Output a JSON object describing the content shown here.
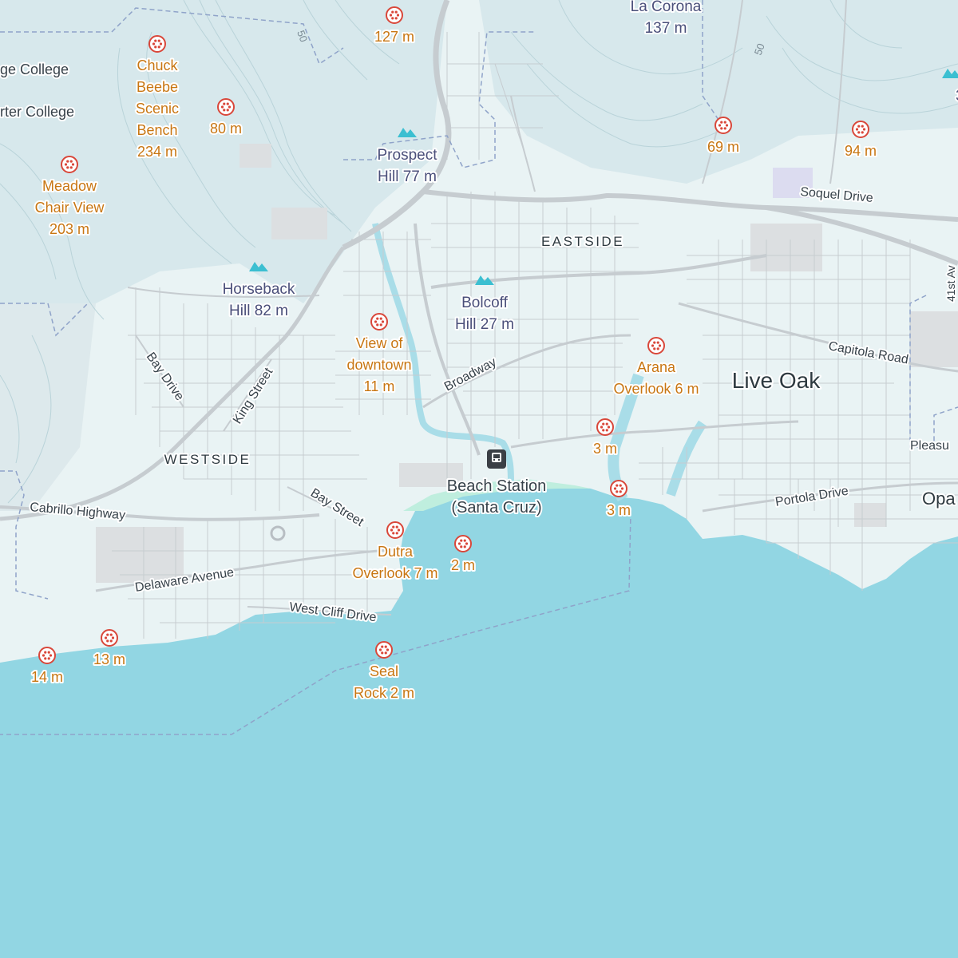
{
  "colors": {
    "water": "#92d6e3",
    "land": "#e9f3f4",
    "hills": "#d7e8ec",
    "contour": "#b9d3d9",
    "road": "#c6ccd0",
    "major_road": "#b8bec3",
    "urban": "#dcdfe1",
    "beach": "#bfeede",
    "viewpoint": "#d9473a",
    "viewpoint_text": "#c87612",
    "peak": "#3bbfd1",
    "peak_text": "#4a4f7a",
    "place_text": "#2e3a40",
    "road_text": "#37424a",
    "boundary": "#8fa3c9"
  },
  "viewpoints": [
    {
      "name": "top-viewpoint",
      "label": [
        "127 m"
      ]
    },
    {
      "name": "chuck-beebe-viewpoint",
      "label": [
        "Chuck",
        "Beebe",
        "Scenic",
        "Bench",
        "234 m"
      ]
    },
    {
      "name": "viewpoint-80",
      "label": [
        "80 m"
      ]
    },
    {
      "name": "meadow-chair-viewpoint",
      "label": [
        "Meadow",
        "Chair View",
        "203 m"
      ]
    },
    {
      "name": "viewpoint-69",
      "label": [
        "69 m"
      ]
    },
    {
      "name": "viewpoint-94",
      "label": [
        "94 m"
      ]
    },
    {
      "name": "view-of-downtown-viewpoint",
      "label": [
        "View of",
        "downtown",
        "11 m"
      ]
    },
    {
      "name": "arana-overlook-viewpoint",
      "label": [
        "Arana",
        "Overlook 6 m"
      ]
    },
    {
      "name": "harbor-viewpoint-a",
      "label": [
        "3 m"
      ]
    },
    {
      "name": "harbor-viewpoint-b",
      "label": [
        "3 m"
      ]
    },
    {
      "name": "dutra-overlook-viewpoint",
      "label": [
        "Dutra",
        "Overlook 7 m"
      ]
    },
    {
      "name": "viewpoint-2",
      "label": [
        "2 m"
      ]
    },
    {
      "name": "viewpoint-13",
      "label": [
        "13 m"
      ]
    },
    {
      "name": "viewpoint-14",
      "label": [
        "14 m"
      ]
    },
    {
      "name": "seal-rock-viewpoint",
      "label": [
        "Seal",
        "Rock 2 m"
      ]
    }
  ],
  "peaks": [
    {
      "name": "prospect-hill-peak",
      "label": [
        "Prospect",
        "Hill 77 m"
      ]
    },
    {
      "name": "horseback-hill-peak",
      "label": [
        "Horseback",
        "Hill 82 m"
      ]
    },
    {
      "name": "bolcoff-hill-peak",
      "label": [
        "Bolcoff",
        "Hill 27 m"
      ]
    },
    {
      "name": "la-corona-peak",
      "label": [
        "La Corona",
        "137 m"
      ]
    },
    {
      "name": "edge-peak",
      "label": [
        "3"
      ]
    }
  ],
  "places": {
    "eastside": "EASTSIDE",
    "westside": "WESTSIDE",
    "live_oak": "Live Oak",
    "opal_partial": "Opa",
    "college_1": "ge College",
    "college_2": "rter College"
  },
  "station": {
    "label": [
      "Beach Station",
      "(Santa Cruz)"
    ],
    "icon": "train-icon"
  },
  "roads": {
    "soquel": "Soquel Drive",
    "capitola": "Capitola Road",
    "portola": "Portola Drive",
    "pleasure": "Pleasu",
    "bay_drive": "Bay Drive",
    "king_street": "King Street",
    "broadway": "Broadway",
    "bay_street": "Bay Street",
    "cabrillo": "Cabrillo Highway",
    "delaware": "Delaware Avenue",
    "west_cliff": "West Cliff Drive",
    "forty_first": "41st Av",
    "route_50_a": "50",
    "route_50_b": "50"
  }
}
